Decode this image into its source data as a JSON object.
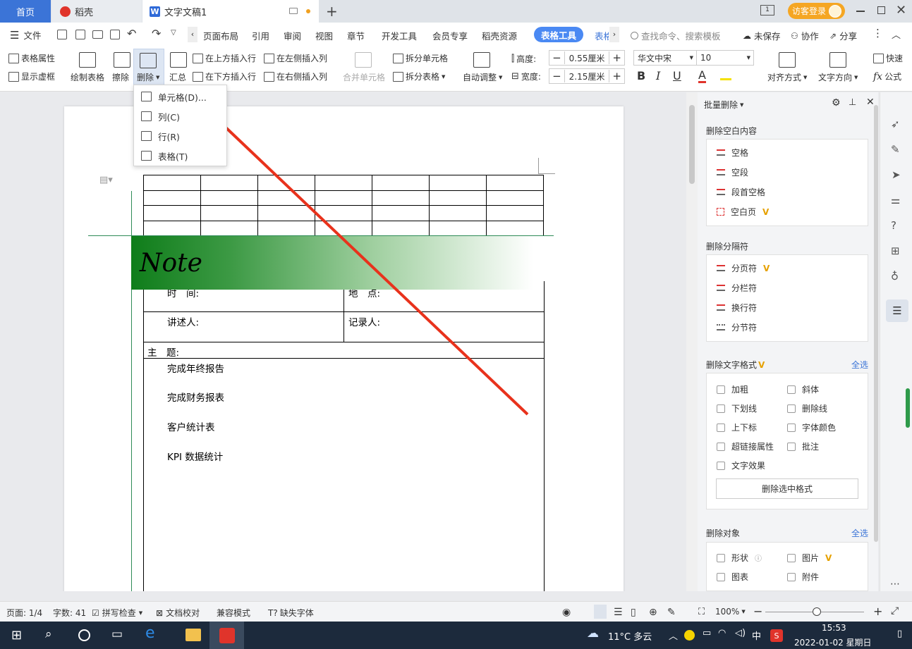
{
  "tabs": {
    "home": "首页",
    "daoke": "稻壳",
    "doc": "文字文稿1"
  },
  "header": {
    "guest_login": "访客登录"
  },
  "menu": {
    "file": "文件",
    "items": [
      "页面布局",
      "引用",
      "审阅",
      "视图",
      "章节",
      "开发工具",
      "会员专享",
      "稻壳资源"
    ],
    "active_tab": "表格工具",
    "more_tab": "表格",
    "search_placeholder": "查找命令、搜索模板",
    "unsaved": "未保存",
    "collab": "协作",
    "share": "分享"
  },
  "ribbon": {
    "table_props": "表格属性",
    "show_grid": "显示虚框",
    "draw_table": "绘制表格",
    "erase": "擦除",
    "delete": "删除",
    "summary": "汇总",
    "insert_above": "在上方插入行",
    "insert_below": "在下方插入行",
    "insert_left": "在左侧插入列",
    "insert_right": "在右侧插入列",
    "merge_cells": "合并单元格",
    "split_cells": "拆分单元格",
    "split_table": "拆分表格",
    "auto_fit": "自动调整",
    "height_label": "高度:",
    "height_value": "0.55厘米",
    "width_label": "宽度:",
    "width_value": "2.15厘米",
    "font_name": "华文中宋",
    "font_size": "10",
    "align": "对齐方式",
    "text_dir": "文字方向",
    "quick": "快速",
    "formula": "公式",
    "bold": "B",
    "italic": "I",
    "underline": "U",
    "font_color": "A"
  },
  "dropdown": {
    "items": [
      {
        "label": "单元格(D)..."
      },
      {
        "label": "列(C)"
      },
      {
        "label": "行(R)"
      },
      {
        "label": "表格(T)"
      }
    ]
  },
  "document": {
    "note_text": "Note",
    "time_label": "时　间:",
    "place_label": "地　点:",
    "speaker_label": "讲述人:",
    "recorder_label": "记录人:",
    "subject_label": "主　题:",
    "items": [
      "完成年终报告",
      "完成财务报表",
      "客户统计表",
      "KPI 数据统计"
    ]
  },
  "panel": {
    "title": "批量删除",
    "sec_blank": "删除空白内容",
    "blank_items": [
      "空格",
      "空段",
      "段首空格",
      "空白页"
    ],
    "sec_sep": "删除分隔符",
    "sep_items": [
      "分页符",
      "分栏符",
      "换行符",
      "分节符"
    ],
    "sec_format": "删除文字格式",
    "select_all": "全选",
    "format_items": [
      "加粗",
      "斜体",
      "下划线",
      "删除线",
      "上下标",
      "字体颜色",
      "超链接属性",
      "批注",
      "文字效果"
    ],
    "delete_format_btn": "删除选中格式",
    "sec_object": "删除对象",
    "select_all_2": "全选",
    "object_items": [
      "形状",
      "图片",
      "图表",
      "附件"
    ]
  },
  "status": {
    "page": "页面: 1/4",
    "words": "字数: 41",
    "spell": "拼写检查",
    "proof": "文档校对",
    "compat": "兼容模式",
    "missing_font": "缺失字体",
    "zoom": "100%"
  },
  "taskbar": {
    "weather": "11°C 多云",
    "ime": "中",
    "time": "15:53",
    "date": "2022-01-02 星期日"
  },
  "colors": {
    "accent": "#3b74d7",
    "active_tab": "#4a89f3",
    "arrow": "#e8321c",
    "note_green": "#12801f",
    "guest": "#f5a623"
  }
}
